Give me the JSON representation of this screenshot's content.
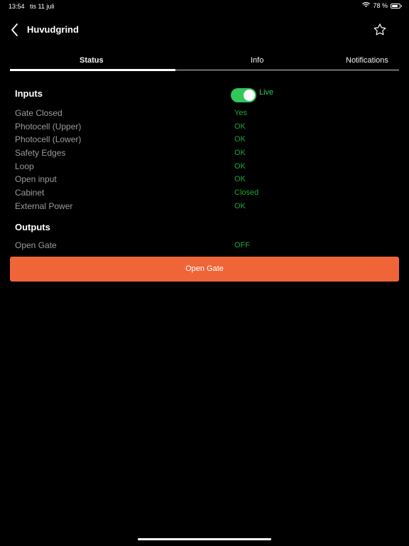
{
  "status_bar": {
    "time": "13:54",
    "date": "tis 11 juli",
    "battery_percent_label": "78 %",
    "battery_level": 0.78,
    "wifi_icon": "wifi-icon",
    "battery_icon": "battery-icon"
  },
  "header": {
    "title": "Huvudgrind",
    "back_icon": "chevron-left-icon",
    "favorite_icon": "star-outline-icon"
  },
  "tabs": [
    {
      "label": "Status",
      "selected": true
    },
    {
      "label": "Info",
      "selected": false
    },
    {
      "label": "Notifications",
      "selected": false
    }
  ],
  "inputs": {
    "heading": "Inputs",
    "live_label": "Live",
    "live_enabled": true,
    "rows": [
      {
        "label": "Gate Closed",
        "value": "Yes"
      },
      {
        "label": "Photocell (Upper)",
        "value": "OK"
      },
      {
        "label": "Photocell (Lower)",
        "value": "OK"
      },
      {
        "label": "Safety Edges",
        "value": "OK"
      },
      {
        "label": "Loop",
        "value": "OK"
      },
      {
        "label": "Open input",
        "value": "OK"
      },
      {
        "label": "Cabinet",
        "value": "Closed"
      },
      {
        "label": "External Power",
        "value": "OK"
      }
    ]
  },
  "outputs": {
    "heading": "Outputs",
    "rows": [
      {
        "label": "Open Gate",
        "value": "OFF"
      }
    ]
  },
  "actions": {
    "open_gate_label": "Open Gate"
  },
  "colors": {
    "background": "#000000",
    "accent": "#ef6538",
    "status_green": "#21a33a",
    "toggle_green": "#32c759",
    "label_gray": "#9b9b9b"
  }
}
